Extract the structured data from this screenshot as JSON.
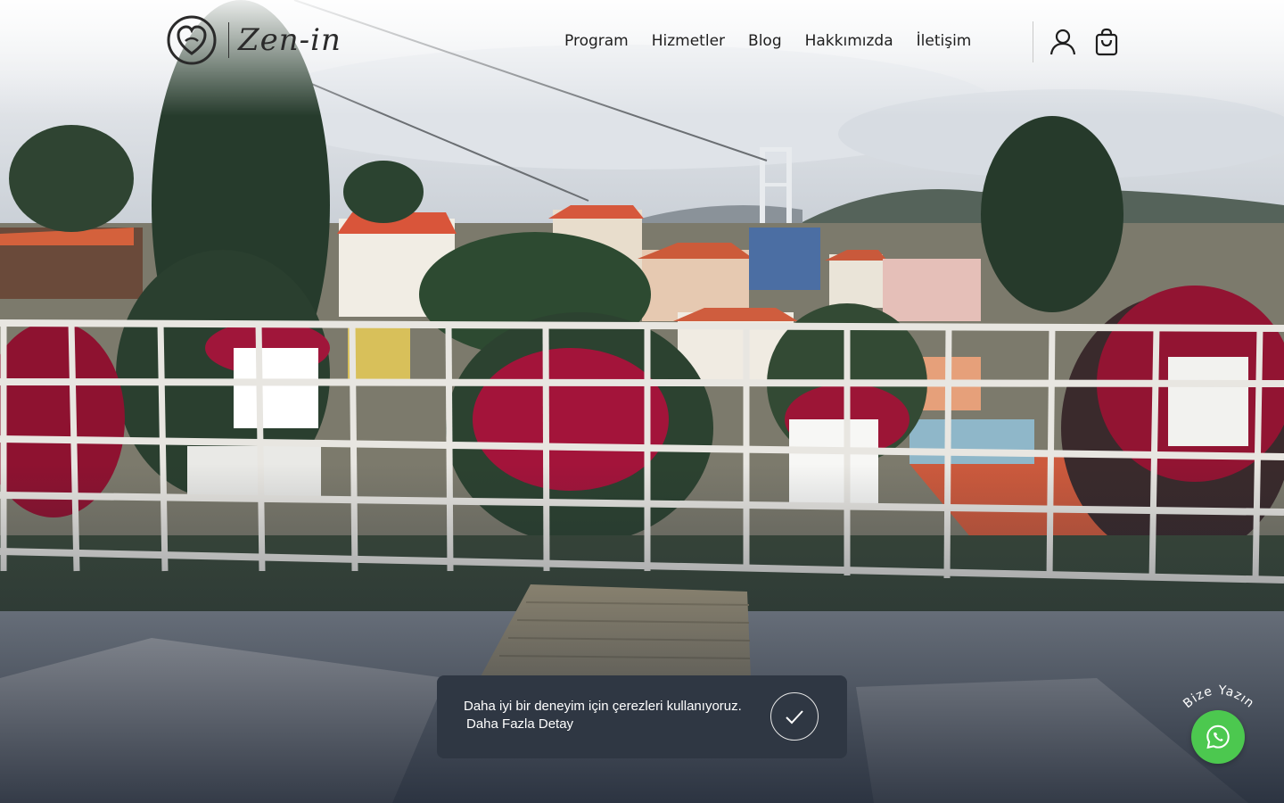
{
  "brand": {
    "logo_text": "Zen-in"
  },
  "nav": {
    "items": [
      "Program",
      "Hizmetler",
      "Blog",
      "Hakkımızda",
      "İletişim"
    ]
  },
  "icons": {
    "user": "user-icon",
    "cart": "shopping-bag-icon",
    "cookie_accept": "checkmark-icon",
    "whatsapp": "whatsapp-icon"
  },
  "cookie": {
    "message": "Daha iyi bir deneyim için çerezleri kullanıyoruz.",
    "link": "Daha Fazla Detay"
  },
  "whatsapp": {
    "label": "Bize Yazın"
  },
  "colors": {
    "cookie_bg": "#2f3743",
    "whatsapp_green": "#4cc84f",
    "nav_text": "#1e1e1e"
  }
}
